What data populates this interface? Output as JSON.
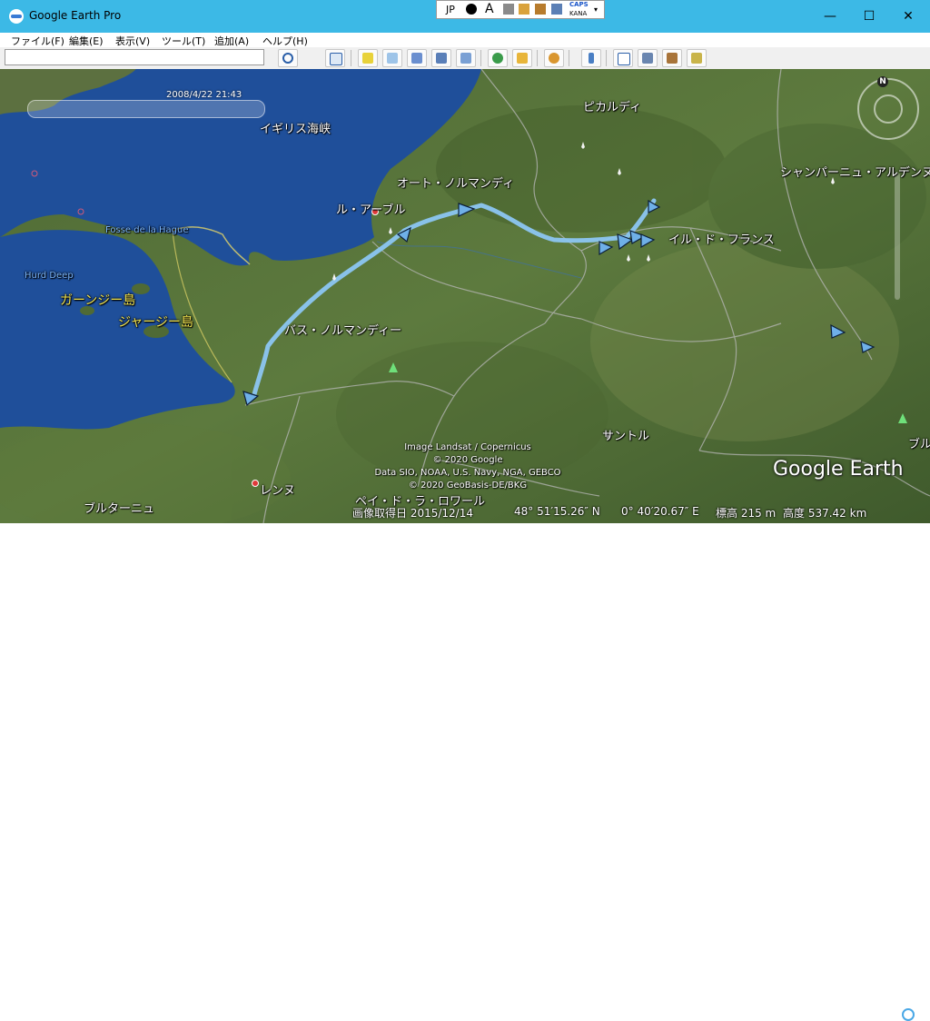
{
  "window": {
    "title": "Google Earth Pro",
    "minimize": "—",
    "maximize": "☐",
    "close": "✕"
  },
  "ime": {
    "lang": "JP",
    "font": "A",
    "caps": "CAPS",
    "kana": "KANA"
  },
  "menu": [
    "ファイル(F)",
    "編集(E)",
    "表示(V)",
    "ツール(T)",
    "追加(A)",
    "ヘルプ(H)"
  ],
  "search": {
    "value": "",
    "button": "search-icon"
  },
  "toolbar_icons": [
    "sidebar-icon",
    "placemark-icon",
    "polygon-icon",
    "path-icon",
    "image-overlay-icon",
    "record-tour-icon",
    "historical-imagery-icon",
    "sunlight-icon",
    "planets-icon",
    "ruler-icon",
    "email-icon",
    "print-icon",
    "save-image-icon",
    "view-in-maps-icon"
  ],
  "map": {
    "timestamp": "2008/4/22  21:43",
    "labels": {
      "picardie": "ピカルディ",
      "channel": "イギリス海峡",
      "haute_normandie": "オート・ノルマンディ",
      "le_havre": "ル・アーブル",
      "ile_de_france": "イル・ド・フランス",
      "champagne": "シャンパーニュ・アルデンヌ",
      "fosse": "Fosse de la Hague",
      "hurd_deep": "Hurd Deep",
      "guernsey": "ガーンジー島",
      "jersey": "ジャージー島",
      "basse_normandie": "バス・ノルマンディー",
      "centre": "サントル",
      "rennes": "レンヌ",
      "bretagne": "ブルターニュ",
      "pays_de_la_loire": "ペイ・ド・ラ・ロワール",
      "bourgogne_partial": "ブル"
    },
    "attribution": [
      "Image Landsat / Copernicus",
      "© 2020 Google",
      "Data SIO, NOAA, U.S. Navy, NGA, GEBCO",
      "© 2020 GeoBasis-DE/BKG"
    ],
    "logo": "Google Earth",
    "compass_n": "N"
  },
  "status": {
    "image_date": "画像取得日  2015/12/14",
    "lat": "48° 51′15.26″ N",
    "lon": "0° 40′20.67″ E",
    "elevation": "標高   215 m",
    "altitude": "高度 537.42 km"
  }
}
